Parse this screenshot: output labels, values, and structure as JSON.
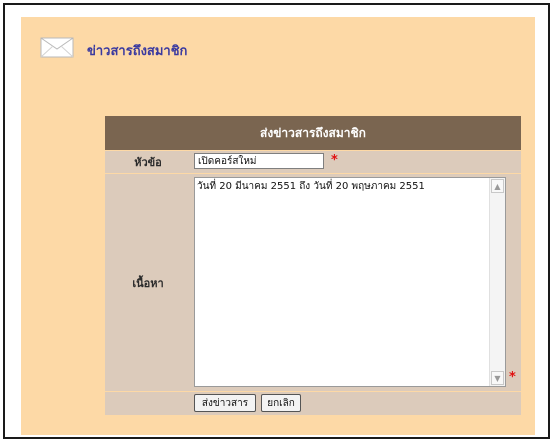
{
  "header": {
    "title": "ข่าวสารถึงสมาชิก",
    "icon": "envelope-icon"
  },
  "form": {
    "title": "ส่งข่าวสารถึงสมาชิก",
    "subject_label": "หัวข้อ",
    "subject_value": "เปิดคอร์สใหม่",
    "body_label": "เนื้อหา",
    "body_value": "วันที่ 20 มีนาคม 2551 ถึง วันที่ 20 พฤษภาคม 2551",
    "required_mark": "*",
    "send_label": "ส่งข่าวสาร",
    "cancel_label": "ยกเลิก"
  },
  "colors": {
    "panel_bg": "#fdd9a6",
    "title_bar": "#7a6550",
    "label_bg": "#dccbbb",
    "header_text": "#3a3aa0",
    "required": "#e01010"
  }
}
